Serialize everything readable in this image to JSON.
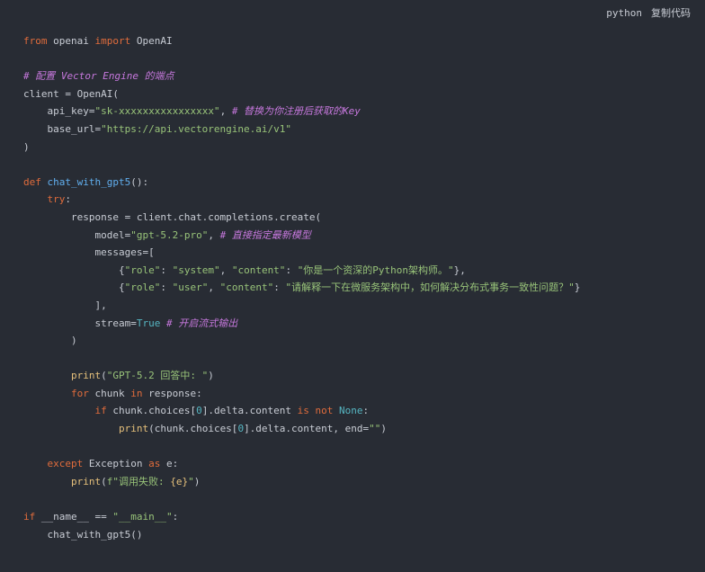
{
  "header": {
    "language": "python",
    "copy_label": "复制代码"
  },
  "code": {
    "lines": [
      [
        {
          "t": "k",
          "v": "from"
        },
        {
          "t": "n",
          "v": " openai "
        },
        {
          "t": "k",
          "v": "import"
        },
        {
          "t": "n",
          "v": " OpenAI"
        }
      ],
      [],
      [
        {
          "t": "cm",
          "v": "# 配置 Vector Engine 的端点"
        }
      ],
      [
        {
          "t": "n",
          "v": "client = OpenAI("
        }
      ],
      [
        {
          "t": "n",
          "v": "    api_key="
        },
        {
          "t": "s",
          "v": "\"sk-xxxxxxxxxxxxxxxx\""
        },
        {
          "t": "n",
          "v": ", "
        },
        {
          "t": "cm",
          "v": "# 替换为你注册后获取的Key"
        }
      ],
      [
        {
          "t": "n",
          "v": "    base_url="
        },
        {
          "t": "s",
          "v": "\"https://api.vectorengine.ai/v1\""
        }
      ],
      [
        {
          "t": "n",
          "v": ")"
        }
      ],
      [],
      [
        {
          "t": "k",
          "v": "def"
        },
        {
          "t": "n",
          "v": " "
        },
        {
          "t": "fn",
          "v": "chat_with_gpt5"
        },
        {
          "t": "n",
          "v": "():"
        }
      ],
      [
        {
          "t": "n",
          "v": "    "
        },
        {
          "t": "k",
          "v": "try"
        },
        {
          "t": "n",
          "v": ":"
        }
      ],
      [
        {
          "t": "n",
          "v": "        response = client.chat.completions.create("
        }
      ],
      [
        {
          "t": "n",
          "v": "            model="
        },
        {
          "t": "s",
          "v": "\"gpt-5.2-pro\""
        },
        {
          "t": "n",
          "v": ", "
        },
        {
          "t": "cm",
          "v": "# 直接指定最新模型"
        }
      ],
      [
        {
          "t": "n",
          "v": "            messages=["
        }
      ],
      [
        {
          "t": "n",
          "v": "                {"
        },
        {
          "t": "s",
          "v": "\"role\""
        },
        {
          "t": "n",
          "v": ": "
        },
        {
          "t": "s",
          "v": "\"system\""
        },
        {
          "t": "n",
          "v": ", "
        },
        {
          "t": "s",
          "v": "\"content\""
        },
        {
          "t": "n",
          "v": ": "
        },
        {
          "t": "s",
          "v": "\"你是一个资深的Python架构师。\""
        },
        {
          "t": "n",
          "v": "},"
        }
      ],
      [
        {
          "t": "n",
          "v": "                {"
        },
        {
          "t": "s",
          "v": "\"role\""
        },
        {
          "t": "n",
          "v": ": "
        },
        {
          "t": "s",
          "v": "\"user\""
        },
        {
          "t": "n",
          "v": ", "
        },
        {
          "t": "s",
          "v": "\"content\""
        },
        {
          "t": "n",
          "v": ": "
        },
        {
          "t": "s",
          "v": "\"请解释一下在微服务架构中，如何解决分布式事务一致性问题？\""
        },
        {
          "t": "n",
          "v": "}"
        }
      ],
      [
        {
          "t": "n",
          "v": "            ],"
        }
      ],
      [
        {
          "t": "n",
          "v": "            stream="
        },
        {
          "t": "c",
          "v": "True"
        },
        {
          "t": "n",
          "v": " "
        },
        {
          "t": "cm",
          "v": "# 开启流式输出"
        }
      ],
      [
        {
          "t": "n",
          "v": "        )"
        }
      ],
      [],
      [
        {
          "t": "n",
          "v": "        "
        },
        {
          "t": "bi",
          "v": "print"
        },
        {
          "t": "n",
          "v": "("
        },
        {
          "t": "s",
          "v": "\"GPT-5.2 回答中: \""
        },
        {
          "t": "n",
          "v": ")"
        }
      ],
      [
        {
          "t": "n",
          "v": "        "
        },
        {
          "t": "k",
          "v": "for"
        },
        {
          "t": "n",
          "v": " chunk "
        },
        {
          "t": "k",
          "v": "in"
        },
        {
          "t": "n",
          "v": " response:"
        }
      ],
      [
        {
          "t": "n",
          "v": "            "
        },
        {
          "t": "k",
          "v": "if"
        },
        {
          "t": "n",
          "v": " chunk.choices["
        },
        {
          "t": "c",
          "v": "0"
        },
        {
          "t": "n",
          "v": "].delta.content "
        },
        {
          "t": "k",
          "v": "is not"
        },
        {
          "t": "n",
          "v": " "
        },
        {
          "t": "c",
          "v": "None"
        },
        {
          "t": "n",
          "v": ":"
        }
      ],
      [
        {
          "t": "n",
          "v": "                "
        },
        {
          "t": "bi",
          "v": "print"
        },
        {
          "t": "n",
          "v": "(chunk.choices["
        },
        {
          "t": "c",
          "v": "0"
        },
        {
          "t": "n",
          "v": "].delta.content, end="
        },
        {
          "t": "s",
          "v": "\"\""
        },
        {
          "t": "n",
          "v": ")"
        }
      ],
      [],
      [
        {
          "t": "n",
          "v": "    "
        },
        {
          "t": "k",
          "v": "except"
        },
        {
          "t": "n",
          "v": " Exception "
        },
        {
          "t": "k",
          "v": "as"
        },
        {
          "t": "n",
          "v": " e:"
        }
      ],
      [
        {
          "t": "n",
          "v": "        "
        },
        {
          "t": "bi",
          "v": "print"
        },
        {
          "t": "n",
          "v": "("
        },
        {
          "t": "s",
          "v": "f\"调用失败: "
        },
        {
          "t": "bi",
          "v": "{e}"
        },
        {
          "t": "s",
          "v": "\""
        },
        {
          "t": "n",
          "v": ")"
        }
      ],
      [],
      [
        {
          "t": "k",
          "v": "if"
        },
        {
          "t": "n",
          "v": " __name__ == "
        },
        {
          "t": "s",
          "v": "\"__main__\""
        },
        {
          "t": "n",
          "v": ":"
        }
      ],
      [
        {
          "t": "n",
          "v": "    chat_with_gpt5()"
        }
      ]
    ]
  }
}
